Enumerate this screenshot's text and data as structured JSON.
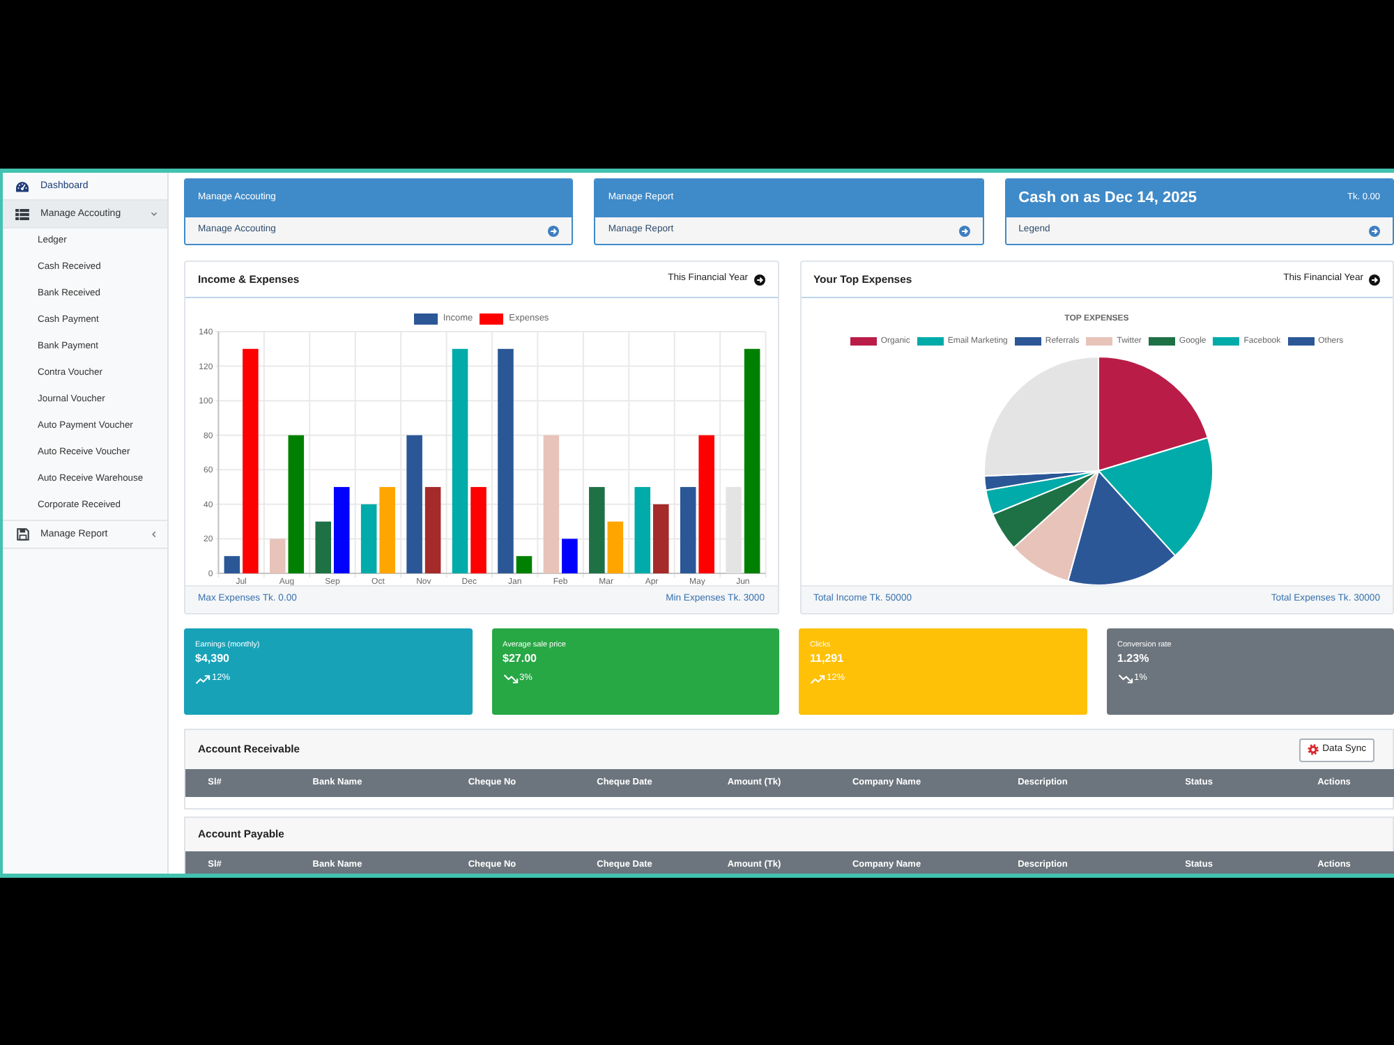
{
  "sidebar": {
    "items": [
      {
        "kind": "link",
        "label": "Dashboard",
        "selected": true
      },
      {
        "kind": "group",
        "label": "Manage Accouting",
        "selected": false,
        "expanded": true,
        "children": [
          {
            "label": "Ledger"
          },
          {
            "label": "Cash Received"
          },
          {
            "label": "Bank Received"
          },
          {
            "label": "Cash Payment"
          },
          {
            "label": "Bank Payment"
          },
          {
            "label": "Contra Voucher"
          },
          {
            "label": "Journal Voucher"
          },
          {
            "label": "Auto Payment Voucher"
          },
          {
            "label": "Auto Receive Voucher"
          },
          {
            "label": "Auto Receive Warehouse"
          },
          {
            "label": "Corporate Received"
          }
        ]
      },
      {
        "kind": "group",
        "label": "Manage Report",
        "selected": false,
        "expanded": false
      }
    ]
  },
  "top_cards": [
    {
      "kind": "link",
      "title": "Manage Accouting",
      "footer": "Manage Accouting"
    },
    {
      "kind": "link",
      "title": "Manage Report",
      "footer": "Manage Report"
    },
    {
      "kind": "summary",
      "title": "Cash on as Dec 14, 2025",
      "amount": "Tk. 0.00",
      "footer": "Legend"
    }
  ],
  "income_expenses": {
    "title": "Income & Expenses",
    "period": "This Financial Year",
    "chart_data": {
      "type": "bar",
      "categories": [
        "Jul",
        "Aug",
        "Sep",
        "Oct",
        "Nov",
        "Dec",
        "Jan",
        "Feb",
        "Mar",
        "Apr",
        "May",
        "Jun"
      ],
      "series": [
        {
          "name": "Income",
          "color": "#2b5797",
          "colors": [
            "#2b5797",
            "#e8c3b9",
            "#1e7145",
            "#00aba9",
            "#2b5797",
            "#00aba9",
            "#2b5797",
            "#e8c3b9",
            "#1e7145",
            "#00aba9",
            "#2b5797",
            "#e4e4e4"
          ],
          "values": [
            10,
            20,
            30,
            40,
            80,
            130,
            130,
            80,
            50,
            50,
            50,
            50
          ]
        },
        {
          "name": "Expenses",
          "color": "#ff0000",
          "colors": [
            "#ff0000",
            "#008000",
            "#0000ff",
            "#ffa500",
            "#a52a2a",
            "#ff0000",
            "#008000",
            "#0000ff",
            "#ffa500",
            "#a52a2a",
            "#ff0000",
            "#008000"
          ],
          "values": [
            130,
            80,
            50,
            50,
            50,
            50,
            10,
            20,
            30,
            40,
            80,
            130
          ]
        }
      ],
      "ylim": [
        0,
        140
      ],
      "yticks": [
        0,
        20,
        40,
        60,
        80,
        100,
        120,
        140
      ],
      "grid": true,
      "legend": "top"
    },
    "footer_left": "Max Expenses Tk. 0.00",
    "footer_right": "Min Expenses Tk. 3000"
  },
  "top_expenses": {
    "title": "Your Top Expenses",
    "period": "This Financial Year",
    "chart_title": "TOP EXPENSES",
    "legend": [
      {
        "label": "Organic",
        "color": "#b91d47"
      },
      {
        "label": "Email Marketing",
        "color": "#00aba9"
      },
      {
        "label": "Referrals",
        "color": "#2b5797"
      },
      {
        "label": "Twitter",
        "color": "#e8c3b9"
      },
      {
        "label": "Google",
        "color": "#1e7145"
      },
      {
        "label": "Facebook",
        "color": "#00aba9"
      },
      {
        "label": "Others",
        "color": "#2b5797"
      }
    ],
    "footer_left": "Total Income Tk. 50000",
    "footer_right": "Total Expenses Tk. 30000"
  },
  "stats": [
    {
      "kind": "up",
      "label": "Earnings (monthly)",
      "value": "$4,390",
      "change": "12%",
      "color": "#17a2b8"
    },
    {
      "kind": "down",
      "label": "Average sale price",
      "value": "$27.00",
      "change": "3%",
      "color": "#28a745"
    },
    {
      "kind": "up",
      "label": "Clicks",
      "value": "11,291",
      "change": "12%",
      "color": "#ffc107"
    },
    {
      "kind": "down",
      "label": "Conversion rate",
      "value": "1.23%",
      "change": "1%",
      "color": "#6c757d"
    }
  ],
  "account_receivable": {
    "title": "Account Receivable",
    "button": "Data Sync",
    "columns": [
      "Sl#",
      "Bank Name",
      "Cheque No",
      "Cheque Date",
      "Amount (Tk)",
      "Company Name",
      "Description",
      "Status",
      "Actions"
    ]
  },
  "account_payable": {
    "title": "Account Payable",
    "columns": [
      "Sl#",
      "Bank Name",
      "Cheque No",
      "Cheque Date",
      "Amount (Tk)",
      "Company Name",
      "Description",
      "Status",
      "Actions"
    ]
  }
}
